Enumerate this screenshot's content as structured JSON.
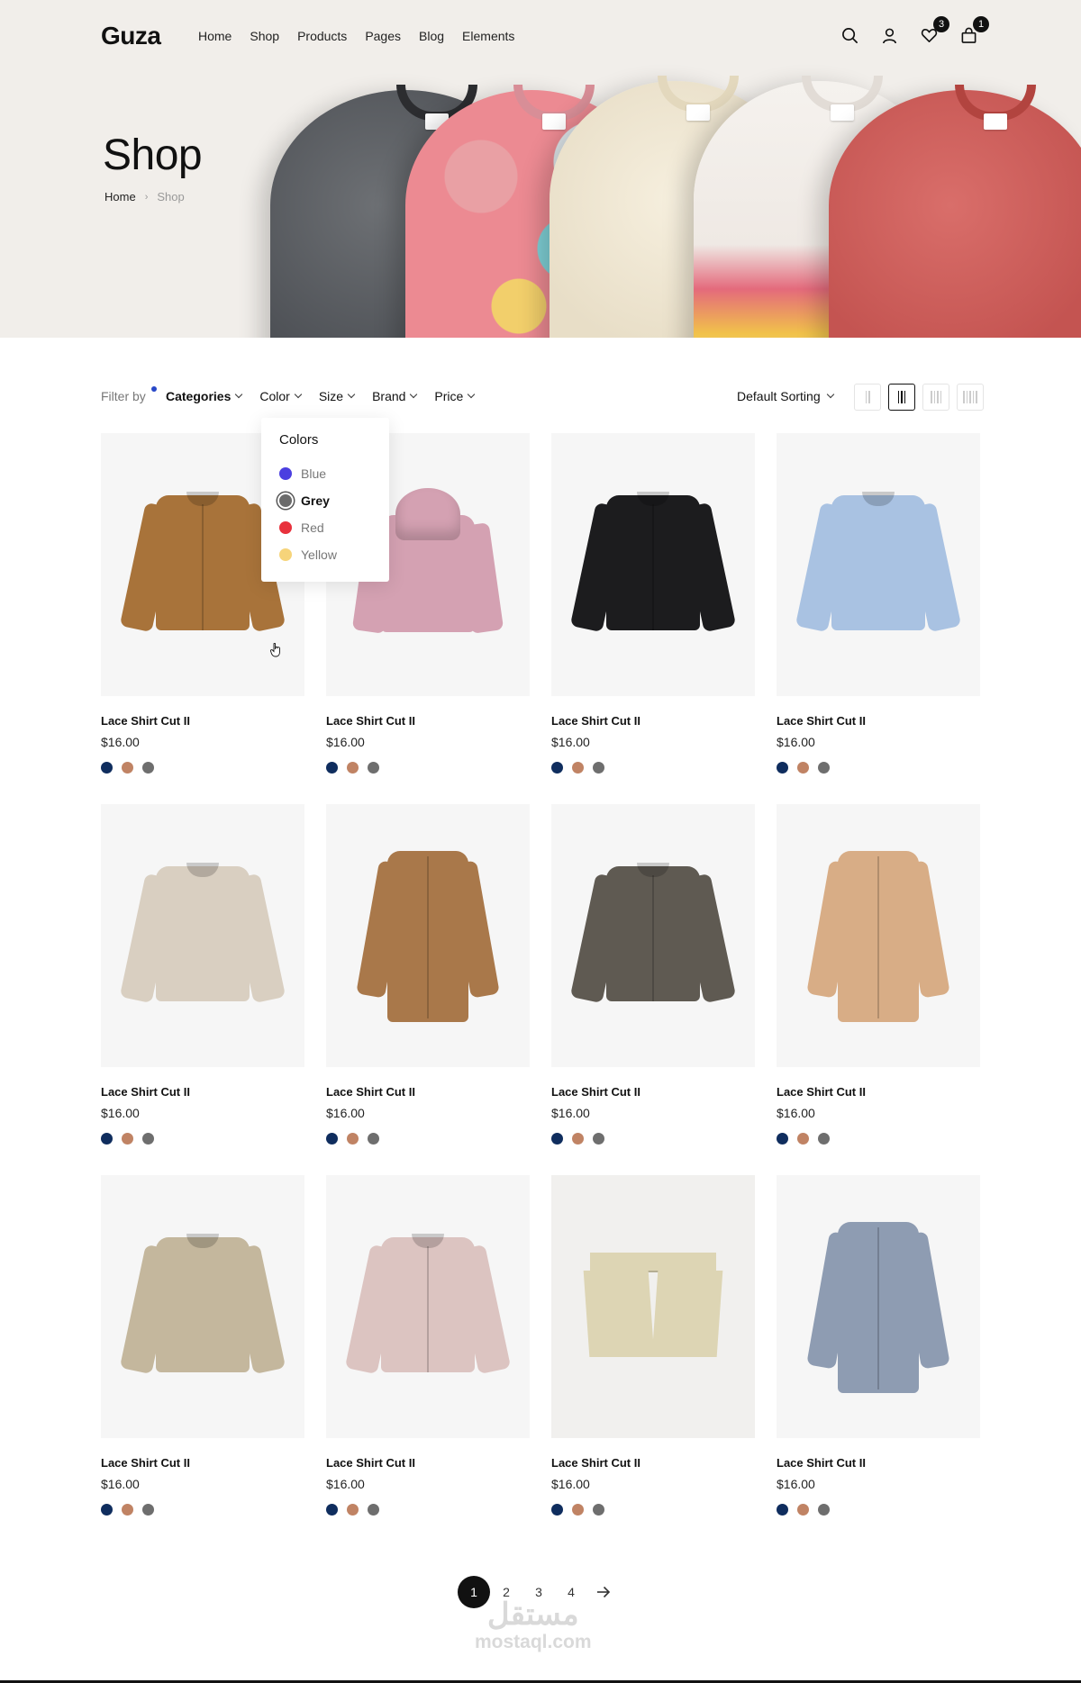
{
  "header": {
    "logo": "Guza",
    "nav": [
      "Home",
      "Shop",
      "Products",
      "Pages",
      "Blog",
      "Elements"
    ],
    "wishlist_count": "3",
    "cart_count": "1"
  },
  "hero": {
    "title": "Shop",
    "breadcrumb_home": "Home",
    "breadcrumb_current": "Shop"
  },
  "filters": {
    "label": "Filter by",
    "items": [
      "Categories",
      "Color",
      "Size",
      "Brand",
      "Price"
    ],
    "sort_label": "Default Sorting"
  },
  "color_dropdown": {
    "title": "Colors",
    "options": [
      {
        "label": "Blue",
        "color": "#4b3fe0"
      },
      {
        "label": "Grey",
        "color": "#6b6b6b"
      },
      {
        "label": "Red",
        "color": "#e8313c"
      },
      {
        "label": "Yellow",
        "color": "#f6d47a"
      }
    ],
    "selected": "Grey"
  },
  "swatch_colors": [
    "#0f2d5e",
    "#c08364",
    "#6e6e6e"
  ],
  "products": [
    {
      "name": "Lace Shirt Cut II",
      "price": "$16.00",
      "garment": "jacket",
      "color": "#a8733a"
    },
    {
      "name": "Lace Shirt Cut II",
      "price": "$16.00",
      "garment": "hoodie",
      "color": "#d4a1b2"
    },
    {
      "name": "Lace Shirt Cut II",
      "price": "$16.00",
      "garment": "jacket",
      "color": "#1c1c1e"
    },
    {
      "name": "Lace Shirt Cut II",
      "price": "$16.00",
      "garment": "sweater",
      "color": "#a9c2e2"
    },
    {
      "name": "Lace Shirt Cut II",
      "price": "$16.00",
      "garment": "sweater",
      "color": "#d9cfc1"
    },
    {
      "name": "Lace Shirt Cut II",
      "price": "$16.00",
      "garment": "coat",
      "color": "#a9784a"
    },
    {
      "name": "Lace Shirt Cut II",
      "price": "$16.00",
      "garment": "jacket",
      "color": "#5f5a52"
    },
    {
      "name": "Lace Shirt Cut II",
      "price": "$16.00",
      "garment": "coat",
      "color": "#d8ad86"
    },
    {
      "name": "Lace Shirt Cut II",
      "price": "$16.00",
      "garment": "sweater",
      "color": "#c4b79d"
    },
    {
      "name": "Lace Shirt Cut II",
      "price": "$16.00",
      "garment": "jacket",
      "color": "#dcc4c1"
    },
    {
      "name": "Lace Shirt Cut II",
      "price": "$16.00",
      "garment": "shorts",
      "color": "#ddd5b4"
    },
    {
      "name": "Lace Shirt Cut II",
      "price": "$16.00",
      "garment": "coat",
      "color": "#8e9cb2"
    }
  ],
  "pagination": {
    "pages": [
      "1",
      "2",
      "3",
      "4"
    ],
    "active": "1"
  },
  "watermark": {
    "arabic": "مستقل",
    "latin": "mostaql.com"
  }
}
